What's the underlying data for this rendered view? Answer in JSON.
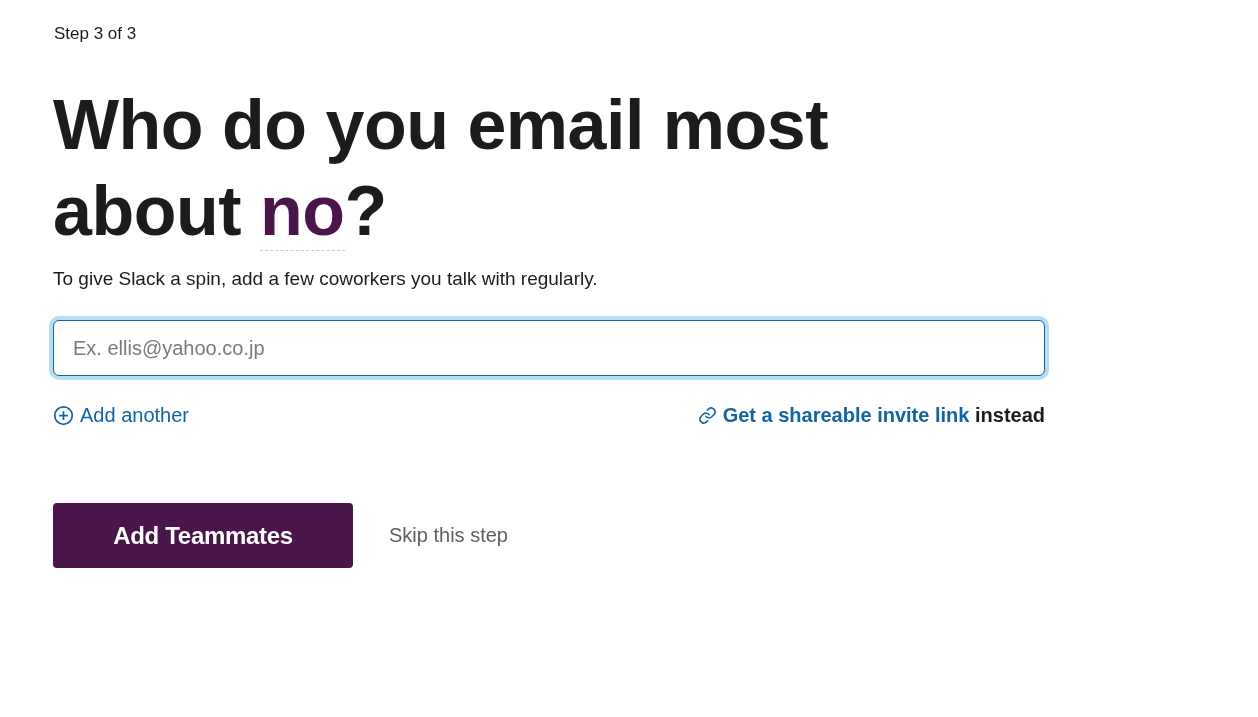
{
  "step": "Step 3 of 3",
  "heading": {
    "before": "Who do you email most about ",
    "highlight": "no",
    "after": "?"
  },
  "subtitle": "To give Slack a spin, add a few coworkers you talk with regularly.",
  "email_field": {
    "placeholder": "Ex. ellis@yahoo.co.jp",
    "focused": true
  },
  "add_another": "Add another",
  "invite": {
    "link": "Get a shareable invite link",
    "after": " instead"
  },
  "primary_button": "Add Teammates",
  "skip_link": "Skip this step"
}
